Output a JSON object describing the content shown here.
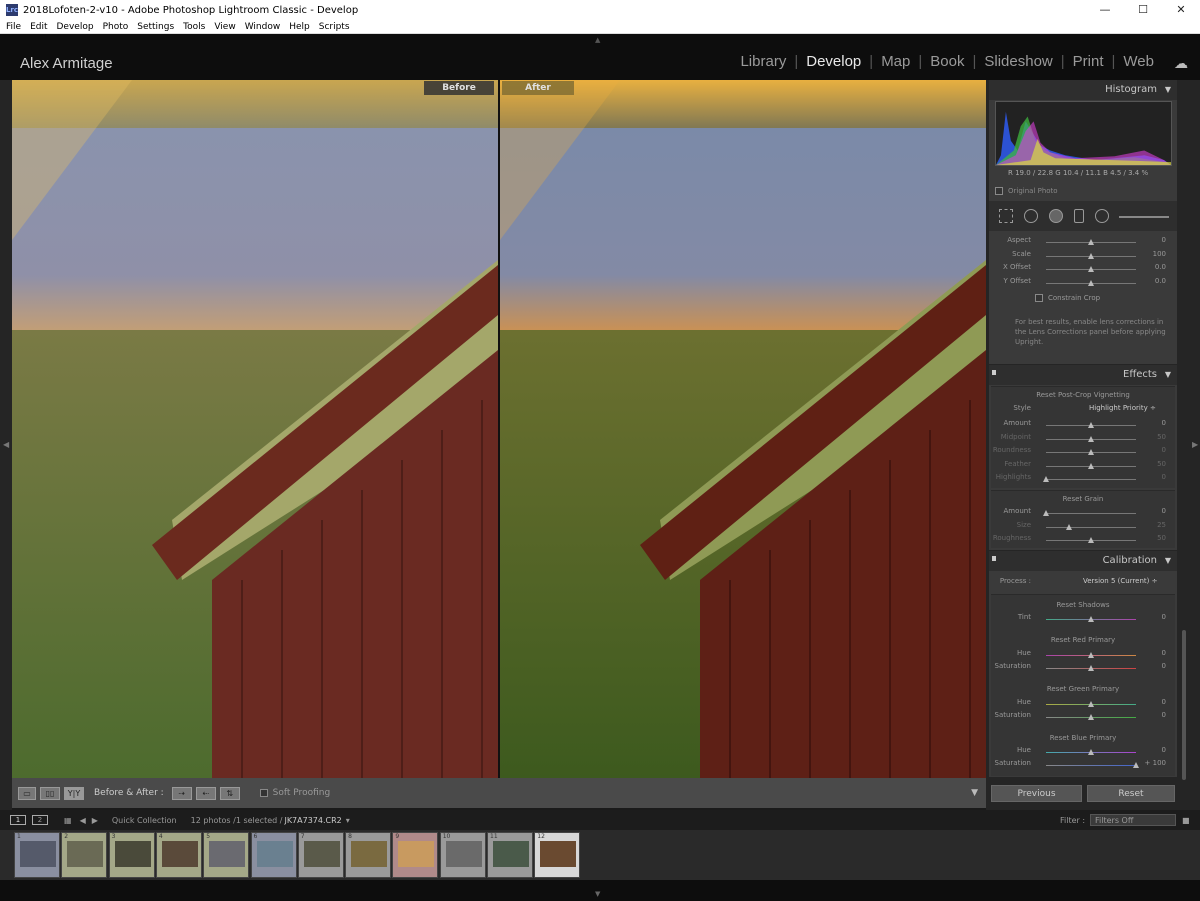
{
  "window": {
    "title": "2018Lofoten-2-v10 - Adobe Photoshop Lightroom Classic - Develop",
    "icon": "Lrc"
  },
  "menu": [
    "File",
    "Edit",
    "Develop",
    "Photo",
    "Settings",
    "Tools",
    "View",
    "Window",
    "Help",
    "Scripts"
  ],
  "identity_plate": "Alex Armitage",
  "modules": [
    "Library",
    "Develop",
    "Map",
    "Book",
    "Slideshow",
    "Print",
    "Web"
  ],
  "active_module": "Develop",
  "view": {
    "before_label": "Before",
    "after_label": "After"
  },
  "toolbar": {
    "before_after_label": "Before & After :",
    "soft_proofing": "Soft Proofing",
    "yy": "Y|Y"
  },
  "histogram": {
    "title": "Histogram",
    "values": "R  19.0 / 22.8   G  10.4 /  11.1   B  4.5 /  3.4  %",
    "original_photo": "Original Photo"
  },
  "transform": {
    "sliders": [
      {
        "label": "Aspect",
        "value": "0",
        "pos": 0.5
      },
      {
        "label": "Scale",
        "value": "100",
        "pos": 0.5
      },
      {
        "label": "X Offset",
        "value": "0.0",
        "pos": 0.5
      },
      {
        "label": "Y Offset",
        "value": "0.0",
        "pos": 0.5
      }
    ],
    "constrain_crop": "Constrain Crop",
    "note": "For best results, enable lens corrections in the Lens Corrections panel before applying Upright."
  },
  "effects": {
    "title": "Effects",
    "vignette_title": "Reset Post-Crop Vignetting",
    "style_label": "Style",
    "style_value": "Highlight Priority ÷",
    "vignette_sliders": [
      {
        "label": "Amount",
        "value": "0",
        "pos": 0.5,
        "dim": false
      },
      {
        "label": "Midpoint",
        "value": "50",
        "pos": 0.5,
        "dim": true
      },
      {
        "label": "Roundness",
        "value": "0",
        "pos": 0.5,
        "dim": true
      },
      {
        "label": "Feather",
        "value": "50",
        "pos": 0.5,
        "dim": true
      },
      {
        "label": "Highlights",
        "value": "0",
        "pos": 0.0,
        "dim": true
      }
    ],
    "grain_title": "Reset Grain",
    "grain_sliders": [
      {
        "label": "Amount",
        "value": "0",
        "pos": 0.0,
        "dim": false
      },
      {
        "label": "Size",
        "value": "25",
        "pos": 0.25,
        "dim": true
      },
      {
        "label": "Roughness",
        "value": "50",
        "pos": 0.5,
        "dim": true
      }
    ]
  },
  "calibration": {
    "title": "Calibration",
    "process_label": "Process :",
    "process_value": "Version 5 (Current) ÷",
    "shadows_title": "Reset Shadows",
    "shadows_tint": {
      "label": "Tint",
      "value": "0",
      "pos": 0.5
    },
    "red_title": "Reset Red Primary",
    "red": [
      {
        "label": "Hue",
        "value": "0",
        "pos": 0.5
      },
      {
        "label": "Saturation",
        "value": "0",
        "pos": 0.5
      }
    ],
    "green_title": "Reset Green Primary",
    "green": [
      {
        "label": "Hue",
        "value": "0",
        "pos": 0.5
      },
      {
        "label": "Saturation",
        "value": "0",
        "pos": 0.5
      }
    ],
    "blue_title": "Reset Blue Primary",
    "blue": [
      {
        "label": "Hue",
        "value": "0",
        "pos": 0.5
      },
      {
        "label": "Saturation",
        "value": "+ 100",
        "pos": 1.0
      }
    ]
  },
  "buttons": {
    "previous": "Previous",
    "reset": "Reset"
  },
  "filmstrip": {
    "pages": [
      "1",
      "2"
    ],
    "source": "Quick Collection",
    "count": "12 photos /1 selected /",
    "filename": "JK7A7374.CR2",
    "filter_label": "Filter :",
    "filter_value": "Filters Off",
    "thumbs": [
      "1",
      "2",
      "3",
      "4",
      "5",
      "6",
      "7",
      "8",
      "9",
      "10",
      "11",
      "12"
    ]
  },
  "colors": {
    "accent_before": "#3a3a3a",
    "accent_after": "#8a7a3a"
  }
}
